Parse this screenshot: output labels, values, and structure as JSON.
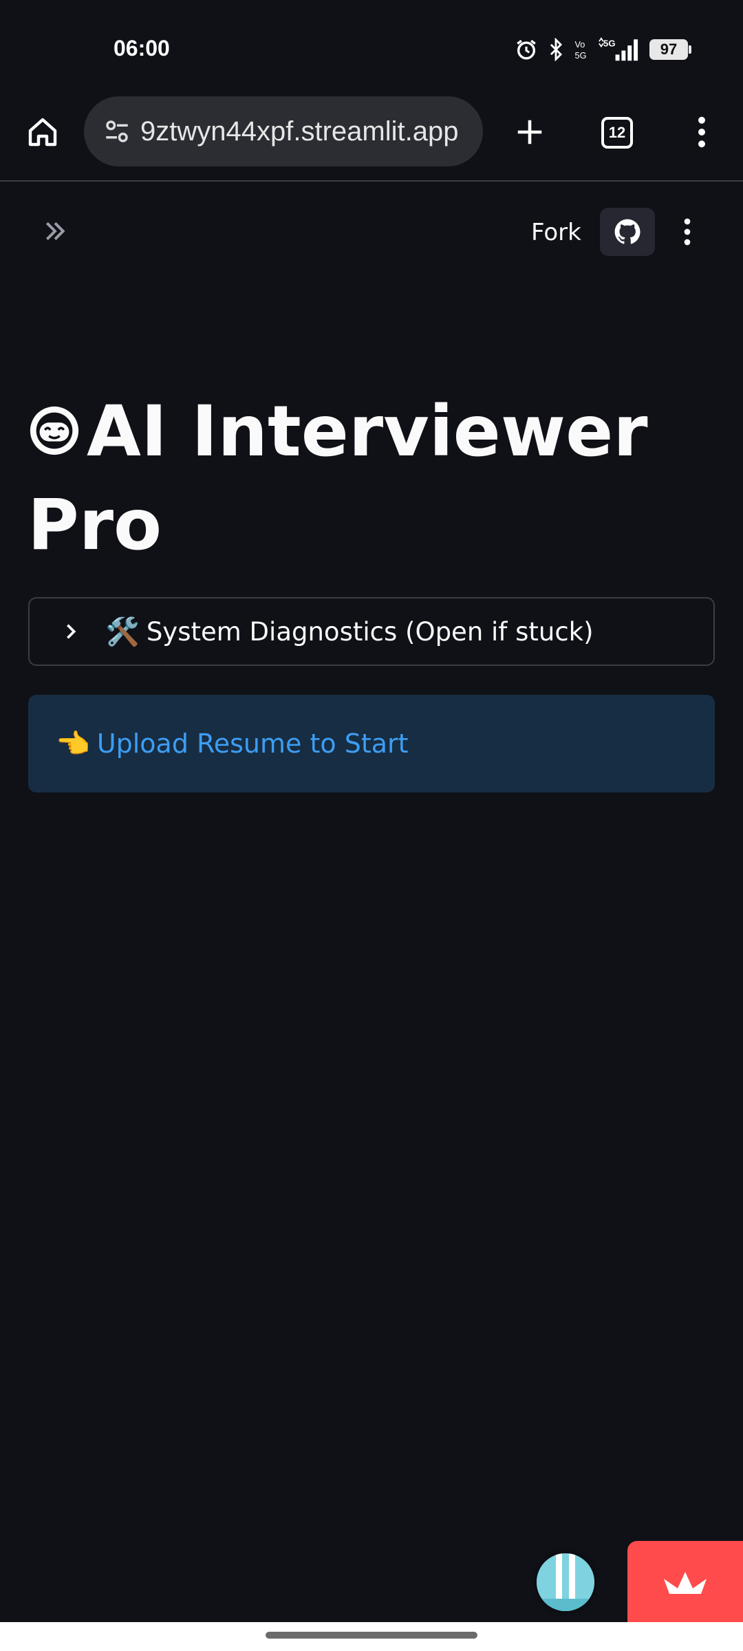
{
  "status_bar": {
    "time": "06:00",
    "battery": "97",
    "icons": [
      "alarm-icon",
      "bluetooth-icon",
      "volte-icon",
      "signal-5g-icon",
      "battery-icon"
    ]
  },
  "browser": {
    "url": "9ztwyn44xpf.streamlit.app",
    "tab_count": "12",
    "icons": [
      "home-icon",
      "site-settings-icon",
      "plus-icon",
      "tabs-icon",
      "more-vert-icon"
    ]
  },
  "app_header": {
    "fork_label": "Fork",
    "icons": [
      "double-chevron-right-icon",
      "github-icon",
      "more-vert-icon"
    ]
  },
  "main": {
    "title": "AI Interviewer Pro",
    "title_icon": "robot-face-emoji",
    "expander": {
      "emoji": "🛠️",
      "label": "System Diagnostics (Open if stuck)"
    },
    "info": {
      "emoji": "👈",
      "text": "Upload Resume to Start"
    }
  },
  "colors": {
    "background": "#0f1117",
    "info_bg": "#172d43",
    "info_text": "#3d9df3",
    "streamlit_red": "#ff4b4b"
  }
}
